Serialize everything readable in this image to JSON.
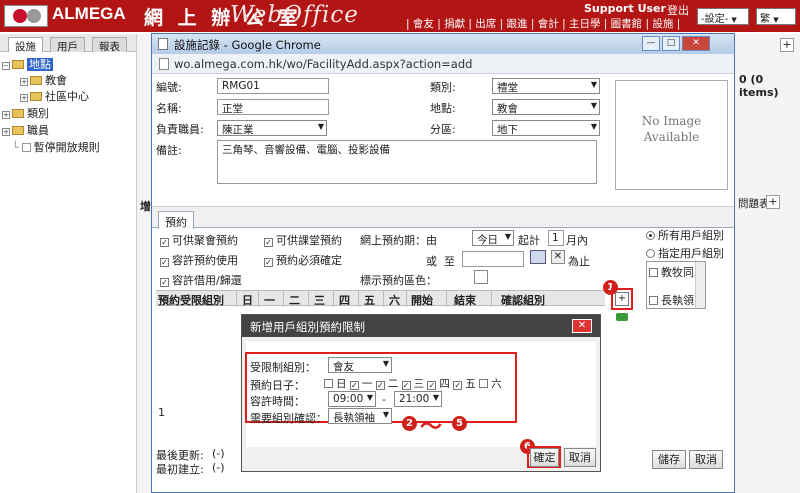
{
  "app": {
    "brand": "ALMEGA",
    "brand_cn": "網 上 辦 公 室",
    "brand_web": "WebOffice",
    "support_user": "Support User",
    "logout": "登出",
    "nav": "| 會友 | 捐獻 | 出席 | 跟進 | 會計 | 主日學 | 圖書館 | 設施 |",
    "settings_select": "-設定-",
    "lang_select": "繁"
  },
  "left_tabs": [
    "設施",
    "用戶",
    "報表"
  ],
  "tree": [
    {
      "label": "地點",
      "selected": true
    },
    {
      "label": "教會"
    },
    {
      "label": "社區中心"
    },
    {
      "label": "類別"
    },
    {
      "label": "職員"
    },
    {
      "label": "暫停開放規則"
    }
  ],
  "background": {
    "items_count": "0 (0 items)",
    "toolbar_label": "問題表",
    "left_label": "增"
  },
  "popup": {
    "title": "設施記錄 - Google Chrome",
    "url": "wo.almega.com.hk/wo/FacilityAdd.aspx?action=add",
    "form": {
      "code_label": "編號:",
      "code_value": "RMG01",
      "category_label": "類別:",
      "category_value": "禮堂",
      "name_label": "名稱:",
      "name_value": "正堂",
      "location_label": "地點:",
      "location_value": "教會",
      "staff_label": "負責職員:",
      "staff_value": "陳正業",
      "zone_label": "分區:",
      "zone_value": "地下",
      "note_label": "備註:",
      "note_value": "三角琴、音響設備、電腦、投影設備",
      "no_image_line1": "No Image",
      "no_image_line2": "Available"
    },
    "reserve_tab": "預約",
    "options": {
      "cb_member_booking": "可供聚會預約",
      "cb_course_booking": "可供課堂預約",
      "online_period_label": "網上預約期：由",
      "period_from": "今日",
      "period_start_label": "起計",
      "period_months": "1",
      "period_months_unit": "月內",
      "cb_allow_use": "容許預約使用",
      "cb_must_confirm": "預約必須確定",
      "or_label": "或",
      "to_label": "至",
      "until_label": "為止",
      "cb_allow_borrow": "容許借用/歸還",
      "color_label": "標示預約區色：",
      "radio_all_groups": "所有用戶組別",
      "radio_specified_groups": "指定用戶組別",
      "group_list": [
        "教牧同工",
        "長執領"
      ]
    },
    "grid": {
      "headers": [
        "預約受限組別",
        "日",
        "一",
        "二",
        "三",
        "四",
        "五",
        "六",
        "開始",
        "結束",
        "確認組別"
      ],
      "row_number": "1"
    },
    "footer": {
      "last_updated_label": "最後更新:",
      "last_updated_value": "(-)",
      "created_label": "最初建立:",
      "created_value": "(-)",
      "save_button": "儲存",
      "cancel_button": "取消"
    },
    "annotations": {
      "badge1": "1",
      "badge2": "2",
      "badge5": "5",
      "badge6": "6",
      "tilde": "～",
      "add_button": "+"
    }
  },
  "dialog": {
    "title": "新增用戶組別預約限制",
    "group_label": "受限制組別：",
    "group_value": "會友",
    "days_label": "預約日子：",
    "days": [
      {
        "label": "日",
        "checked": false
      },
      {
        "label": "一",
        "checked": true
      },
      {
        "label": "二",
        "checked": true
      },
      {
        "label": "三",
        "checked": true
      },
      {
        "label": "四",
        "checked": true
      },
      {
        "label": "五",
        "checked": true
      },
      {
        "label": "六",
        "checked": false
      }
    ],
    "time_label": "容許時間：",
    "time_from": "09:00",
    "time_sep": "-",
    "time_to": "21:00",
    "confirm_label": "需要組別確認：",
    "confirm_value": "長執領袖",
    "ok_button": "確定",
    "cancel_button": "取消"
  },
  "colors": {
    "topbar": "#b31515",
    "annotation_red": "#e01e1e",
    "selected_blue": "#2f64c8"
  }
}
